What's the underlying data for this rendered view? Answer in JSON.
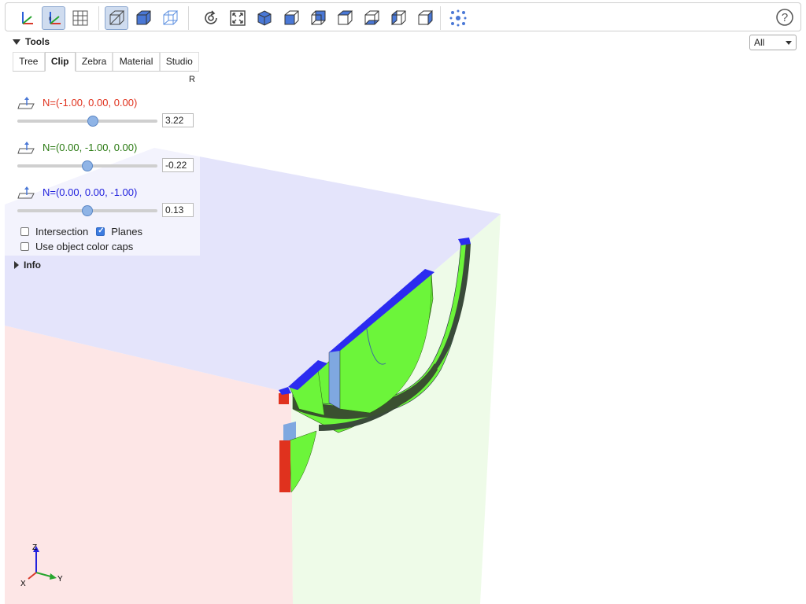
{
  "tools": {
    "title": "Tools",
    "tabs": [
      "Tree",
      "Clip",
      "Zebra",
      "Material",
      "Studio"
    ],
    "active_tab": "Clip",
    "reset_label": "R",
    "planes": [
      {
        "normal": "N=(-1.00, 0.00, 0.00)",
        "value": "3.22",
        "color": "#e0321e",
        "slider_fraction": 0.54
      },
      {
        "normal": "N=(0.00, -1.00, 0.00)",
        "value": "-0.22",
        "color": "#2a7a12",
        "slider_fraction": 0.5
      },
      {
        "normal": "N=(0.00, 0.00, -1.00)",
        "value": "0.13",
        "color": "#2222dd",
        "slider_fraction": 0.5
      }
    ],
    "intersection_label": "Intersection",
    "intersection_checked": false,
    "planes_label": "Planes",
    "planes_checked": true,
    "caps_label": "Use object color caps",
    "caps_checked": false
  },
  "info": {
    "title": "Info"
  },
  "filter": {
    "selected": "All"
  },
  "axes": {
    "x": "X",
    "y": "Y",
    "z": "Z"
  },
  "toolbar": {
    "buttons": [
      "axes-icon",
      "axes-origin-icon",
      "grid-icon",
      "perspective-icon",
      "shaded-cube-icon",
      "wireframe-cube-icon",
      "reset-view-icon",
      "fit-view-icon",
      "iso-view-icon",
      "front-view-icon",
      "rear-view-icon",
      "top-view-icon",
      "bottom-view-icon",
      "left-view-icon",
      "right-view-icon",
      "explode-icon",
      "help-icon"
    ]
  },
  "colors": {
    "plane_x": "#fde6e6",
    "plane_y": "#eefbe8",
    "plane_z": "#e4e4fb",
    "object_green": "#6cf53a",
    "cap_blue": "#2b2bf0",
    "cap_red": "#e0321e",
    "inner_face": "#7fa8e0"
  }
}
